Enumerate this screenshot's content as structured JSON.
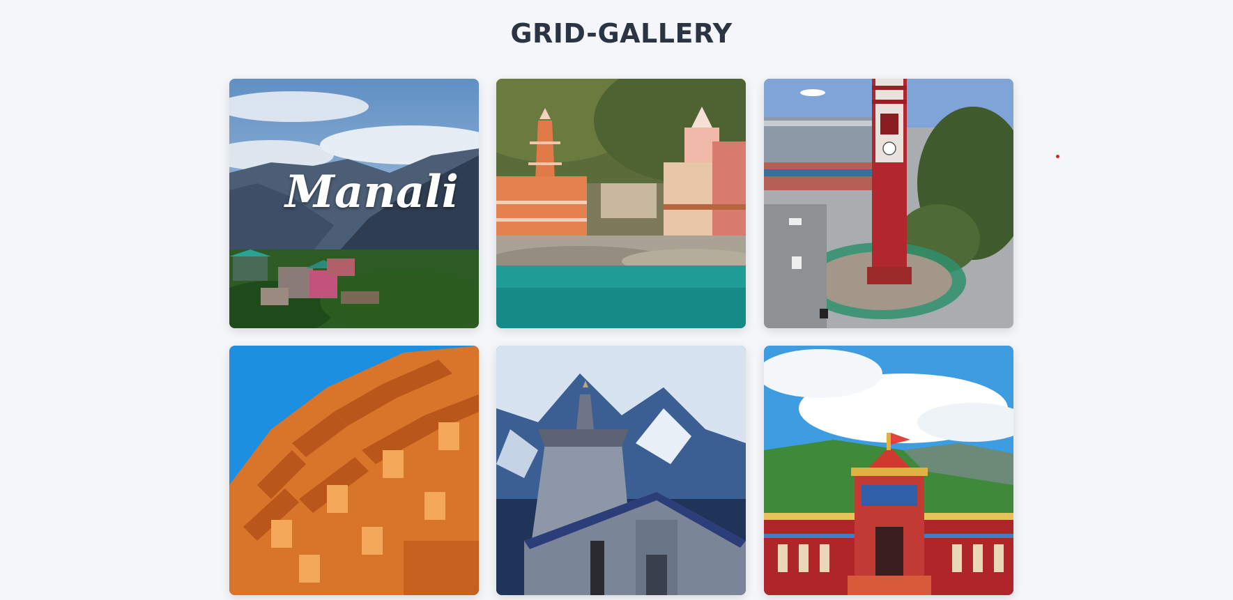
{
  "page": {
    "title": "GRID-GALLERY"
  },
  "gallery": {
    "tiles": [
      {
        "overlay_text": "Manali"
      },
      {},
      {},
      {},
      {},
      {}
    ]
  },
  "colors": {
    "background": "#f5f6fa",
    "title": "#2b3442",
    "marker_dot": "#e11d2a"
  }
}
